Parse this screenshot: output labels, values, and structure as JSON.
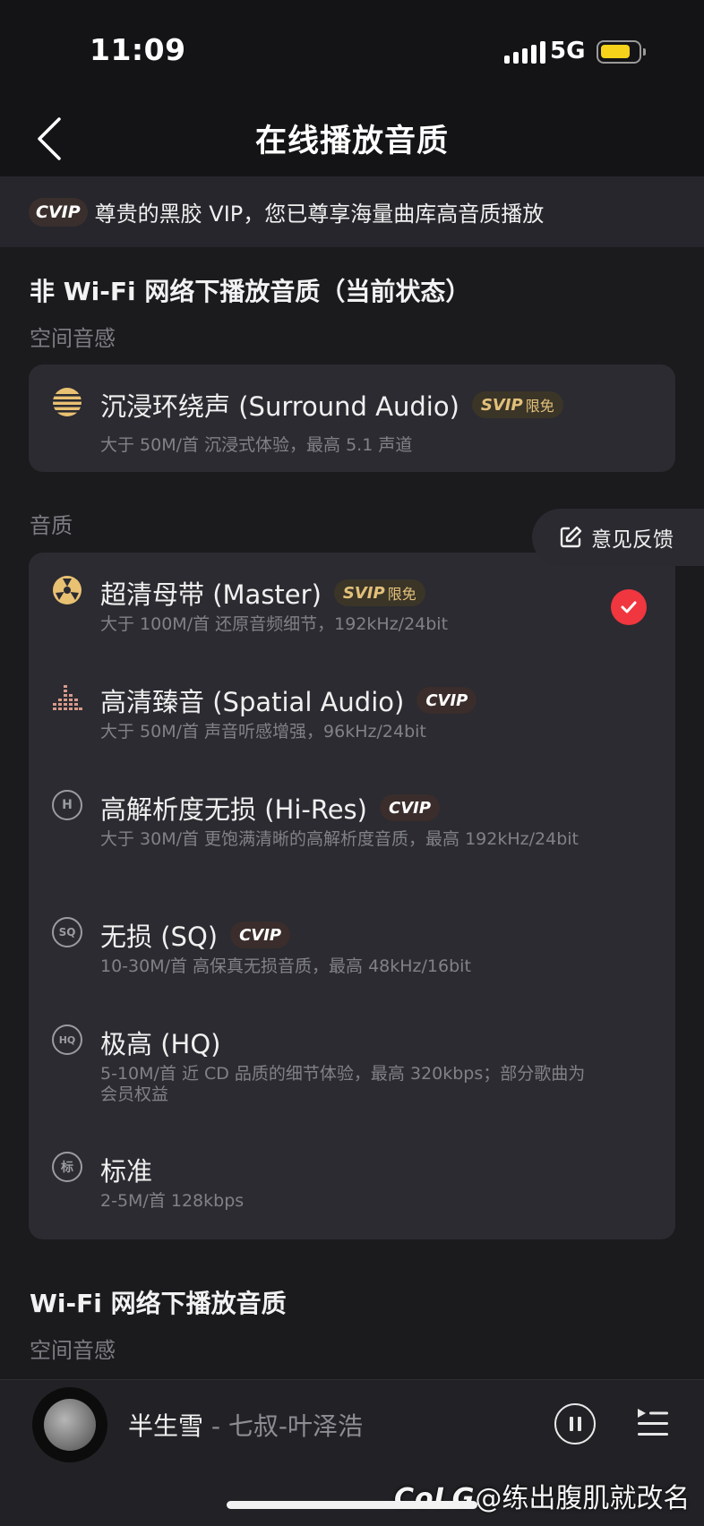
{
  "status": {
    "time": "11:09",
    "network": "5G"
  },
  "nav": {
    "title": "在线播放音质"
  },
  "banner": {
    "badge": "CVIP",
    "text": "尊贵的黑胶 VIP，您已尊享海量曲库高音质播放"
  },
  "mobile": {
    "title": "非 Wi-Fi 网络下播放音质（当前状态）",
    "spatial_label": "空间音感",
    "spatial_options": [
      {
        "title": "沉浸环绕声 (Surround Audio)",
        "badge": "SVIP",
        "badge_free": "限免",
        "desc": "大于 50M/首  沉浸式体验，最高 5.1 声道",
        "icon": "surround-icon"
      }
    ],
    "quality_label": "音质",
    "quality_options": [
      {
        "title": "超清母带 (Master)",
        "badge": "SVIP",
        "badge_free": "限免",
        "desc": "大于 100M/首  还原音频细节，192kHz/24bit",
        "icon": "master-icon",
        "selected": true
      },
      {
        "title": "高清臻音 (Spatial Audio)",
        "badge": "CVIP",
        "desc": "大于 50M/首  声音听感增强，96kHz/24bit",
        "icon": "equalizer-icon"
      },
      {
        "title": "高解析度无损 (Hi-Res)",
        "badge": "CVIP",
        "desc": "大于 30M/首  更饱满清晰的高解析度音质，最高 192kHz/24bit",
        "icon": "hires-icon",
        "icon_text": "H"
      },
      {
        "title": "无损 (SQ)",
        "badge": "CVIP",
        "desc": "10-30M/首  高保真无损音质，最高 48kHz/16bit",
        "icon": "sq-icon",
        "icon_text": "SQ"
      },
      {
        "title": "极高 (HQ)",
        "desc": "5-10M/首  近 CD 品质的细节体验，最高 320kbps；部分歌曲为会员权益",
        "icon": "hq-icon",
        "icon_text": "HQ"
      },
      {
        "title": "标准",
        "desc": "2-5M/首  128kbps",
        "icon": "standard-icon",
        "icon_text": "标"
      }
    ]
  },
  "wifi": {
    "title": "Wi-Fi 网络下播放音质",
    "spatial_label": "空间音感"
  },
  "feedback": {
    "label": "意见反馈"
  },
  "player": {
    "song": "半生雪",
    "artist": " - 七叔-叶泽浩"
  },
  "watermark": {
    "logo": "CoLG",
    "handle": "@练出腹肌就改名"
  },
  "colors": {
    "accent_red": "#f0363f",
    "gold": "#e2c07a",
    "background": "#1b1b1e",
    "card": "#2b2b31"
  }
}
